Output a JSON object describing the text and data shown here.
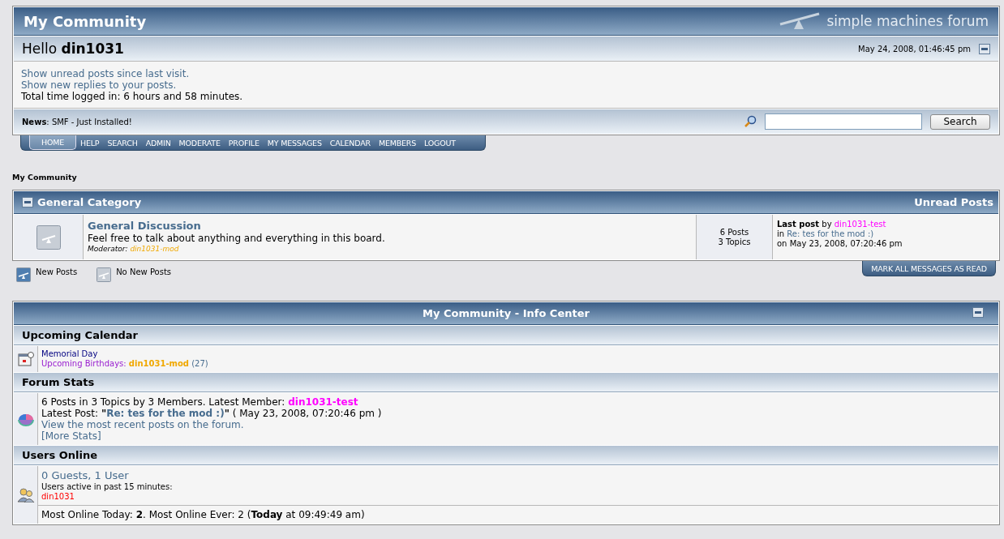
{
  "header": {
    "title": "My Community",
    "logo_text": "simple machines forum",
    "greeting": "Hello **din1031**",
    "date": "May 24, 2008, 01:46:45 pm",
    "links": [
      "Show unread posts since last visit.",
      "Show new replies to your posts."
    ],
    "time_logged": "Total time logged in: 6 hours and 58 minutes.",
    "news": "**News**: SMF - Just Installed!",
    "search": {
      "button": "Search"
    }
  },
  "menu": [
    {
      "label": "HOME",
      "selected": true
    },
    {
      "label": "HELP",
      "selected": false
    },
    {
      "label": "SEARCH",
      "selected": false
    },
    {
      "label": "ADMIN",
      "selected": false
    },
    {
      "label": "MODERATE",
      "selected": false
    },
    {
      "label": "PROFILE",
      "selected": false
    },
    {
      "label": "MY MESSAGES",
      "selected": false
    },
    {
      "label": "CALENDAR",
      "selected": false
    },
    {
      "label": "MEMBERS",
      "selected": false
    },
    {
      "label": "LOGOUT",
      "selected": false
    }
  ],
  "breadcrumb": "My Community",
  "category": {
    "title": "General Category",
    "unread_link": "Unread Posts",
    "boards": [
      {
        "kind": "no_new",
        "name": "General Discussion",
        "description": "Feel free to talk about anything and everything in this board.",
        "moderator_label": "Moderator:",
        "moderator": "din1031-mod",
        "posts": "6 Posts",
        "topics": "3 Topics",
        "last_post_label": "**Last post** by",
        "last_post_user": "din1031-test",
        "in_label": "in",
        "last_post_topic": "Re: tes for the mod :)",
        "last_post_date": "on May 23, 2008, 07:20:46 pm"
      }
    ]
  },
  "legend": [
    {
      "kind": "new",
      "label": "New Posts"
    },
    {
      "kind": "no_new",
      "label": "No New Posts"
    }
  ],
  "mark_read_button": "MARK ALL MESSAGES AS READ",
  "info_center": {
    "title": "My Community - Info Center",
    "sections": [
      {
        "kind": "calendar",
        "title": "Upcoming Calendar",
        "event": "Memorial Day",
        "birthdays_label": "Upcoming Birthdays:",
        "birthday_user": "din1031-mod",
        "birthday_age": "(27)"
      },
      {
        "kind": "stats",
        "title": "Forum Stats",
        "summary": "6 Posts in 3 Topics by 3 Members. Latest Member:",
        "latest_member": "din1031-test",
        "latest_post_label": "Latest Post: **\"**",
        "latest_post_topic": "Re: tes for the mod :)",
        "latest_post_date": "**\"** ( May 23, 2008, 07:20:46 pm )",
        "recent_link": "View the most recent posts on the forum.",
        "more_stats_link": "[More Stats]"
      },
      {
        "kind": "online",
        "title": "Users Online",
        "counts_link": "0 Guests, 1 User",
        "active_label": "Users active in past 15 minutes:",
        "active_user": "din1031",
        "most_online": "Most Online Today: **2**. Most Online Ever: 2 (**Today** at 09:49:49 am)"
      }
    ]
  }
}
